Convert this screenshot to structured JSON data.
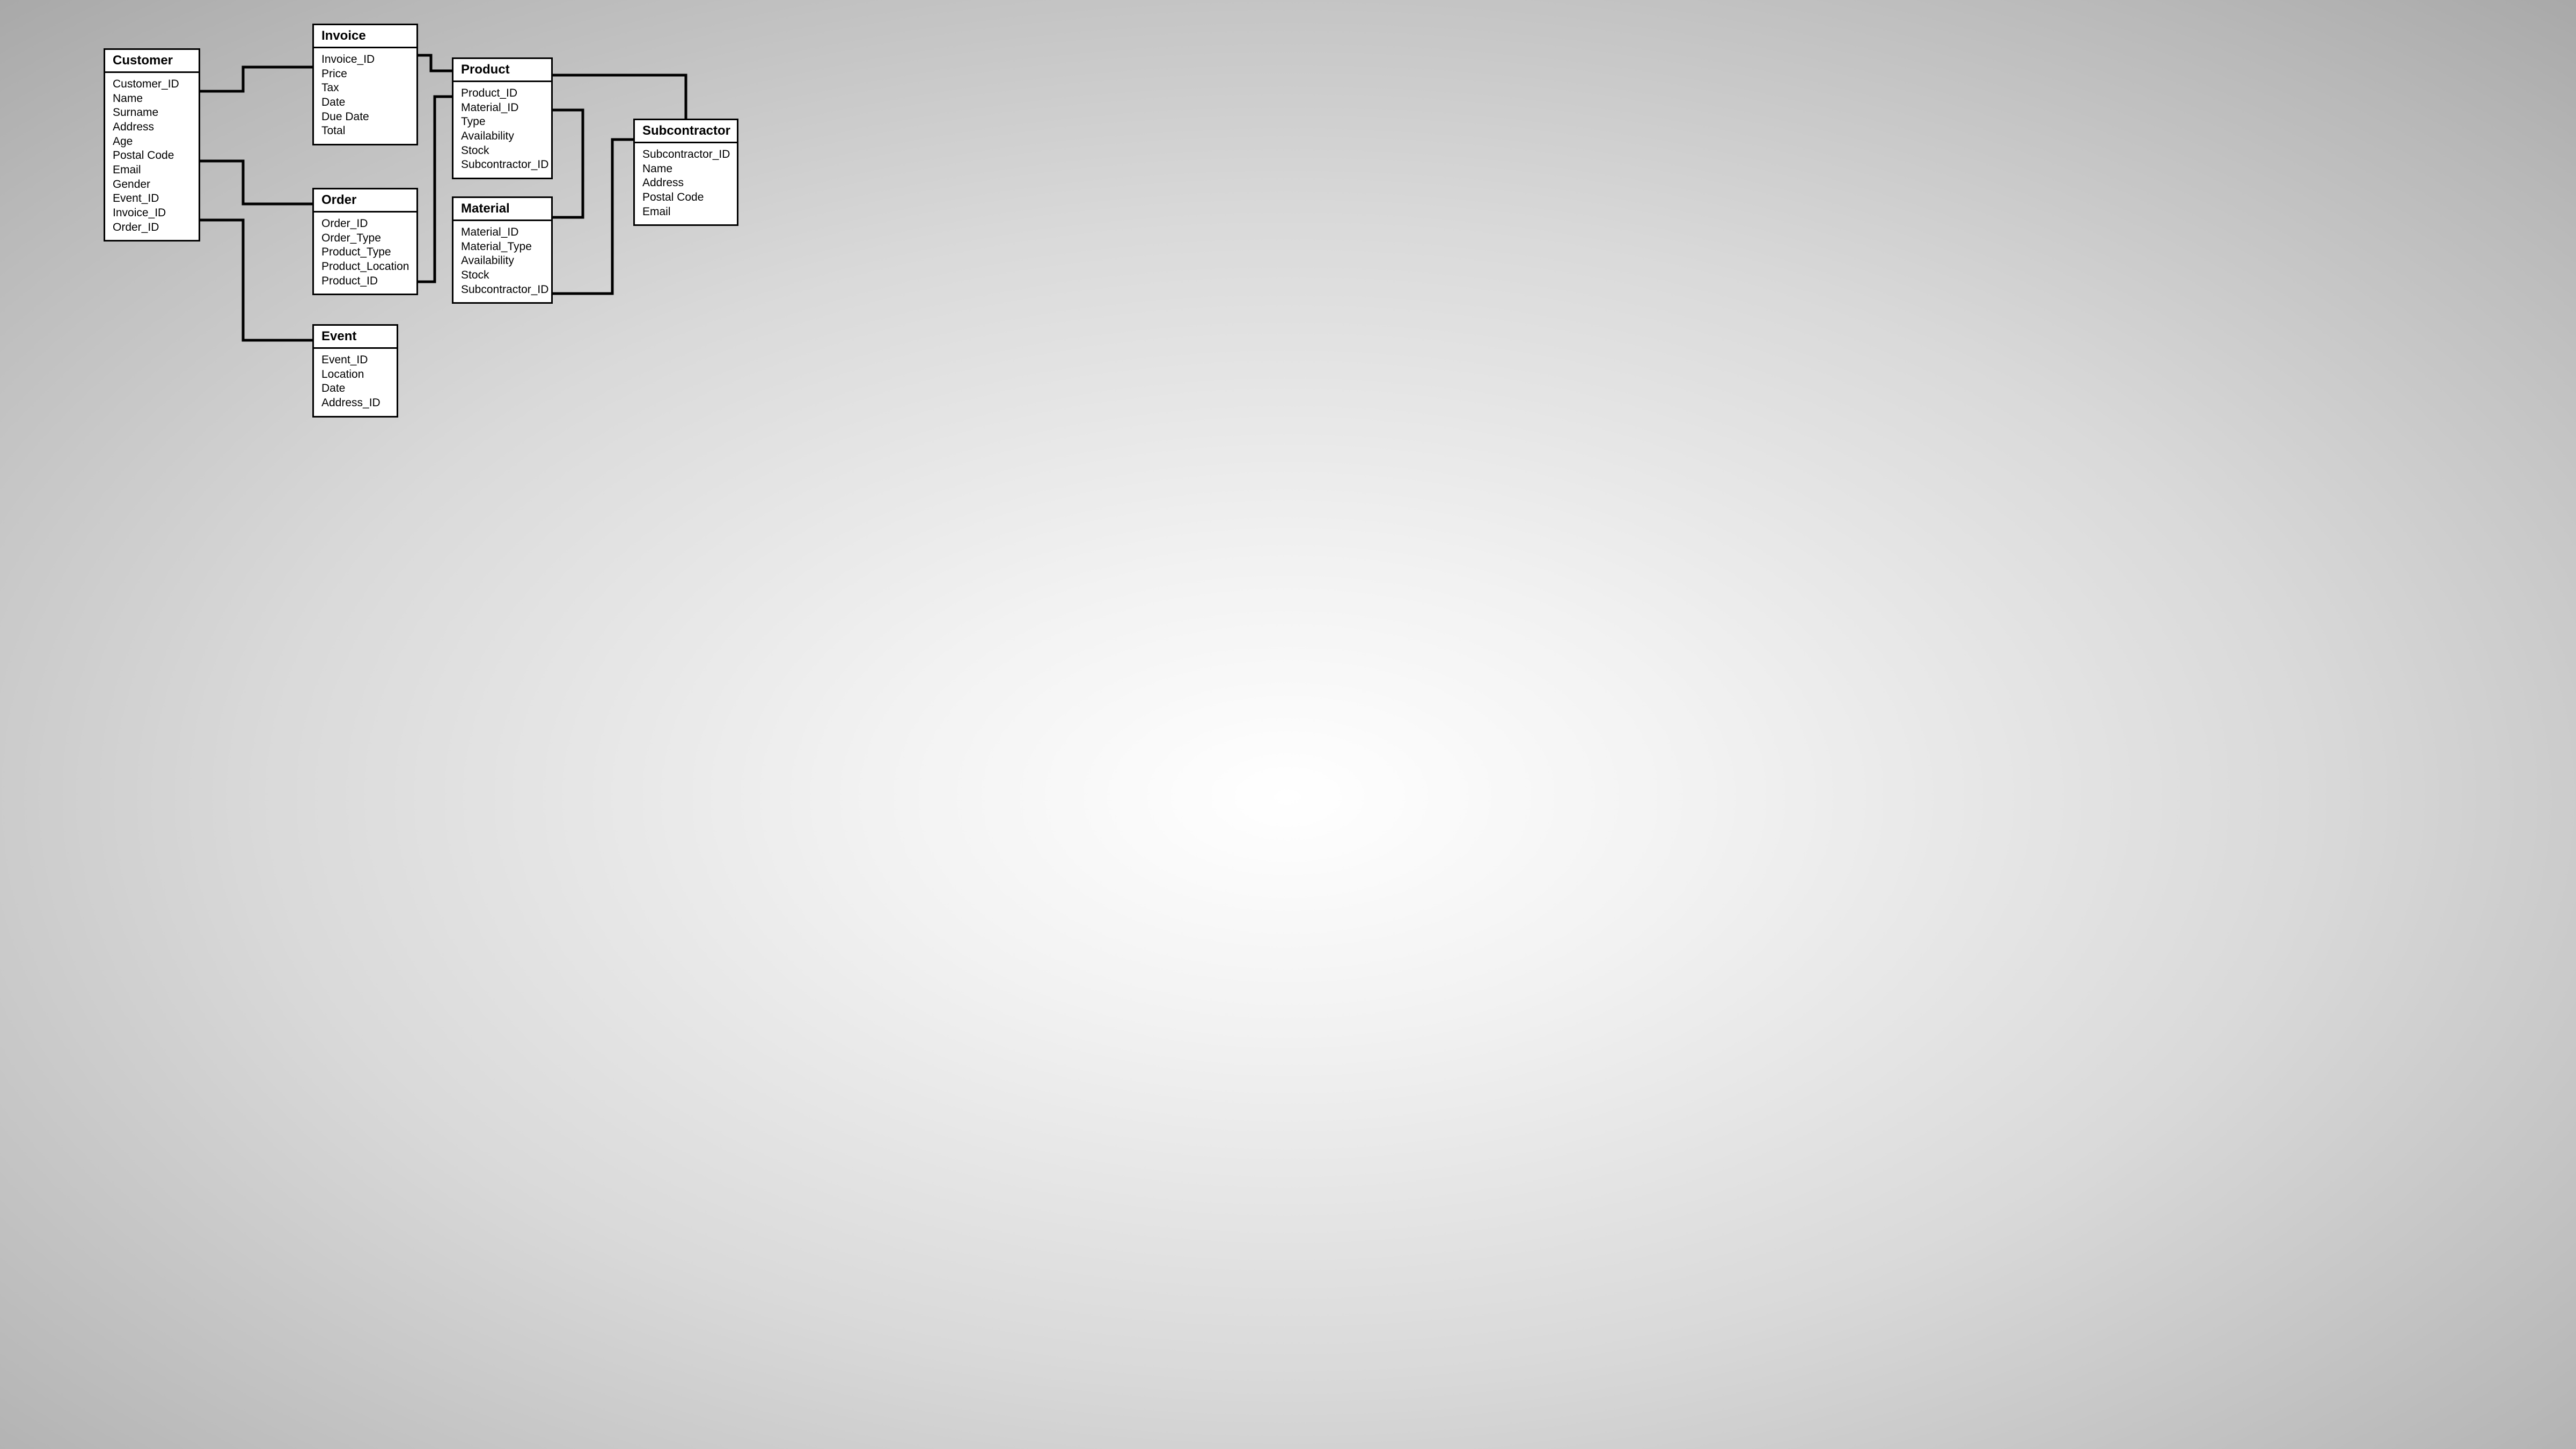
{
  "entities": {
    "customer": {
      "title": "Customer",
      "attrs": [
        "Customer_ID",
        "Name",
        "Surname",
        "Address",
        "Age",
        "Postal Code",
        "Email",
        "Gender",
        "Event_ID",
        "Invoice_ID",
        "Order_ID"
      ]
    },
    "invoice": {
      "title": "Invoice",
      "attrs": [
        "Invoice_ID",
        "Price",
        "Tax",
        "Date",
        "Due Date",
        "Total"
      ]
    },
    "order": {
      "title": "Order",
      "attrs": [
        "Order_ID",
        "Order_Type",
        "Product_Type",
        "Product_Location",
        "Product_ID"
      ]
    },
    "event": {
      "title": "Event",
      "attrs": [
        "Event_ID",
        "Location",
        "Date",
        "Address_ID"
      ]
    },
    "product": {
      "title": "Product",
      "attrs": [
        "Product_ID",
        "Material_ID",
        "Type",
        "Availability",
        "Stock",
        "Subcontractor_ID"
      ]
    },
    "material": {
      "title": "Material",
      "attrs": [
        "Material_ID",
        "Material_Type",
        "Availability",
        "Stock",
        "Subcontractor_ID"
      ]
    },
    "subcontractor": {
      "title": "Subcontractor",
      "attrs": [
        "Subcontractor_ID",
        "Name",
        "Address",
        "Postal Code",
        "Email"
      ]
    }
  }
}
